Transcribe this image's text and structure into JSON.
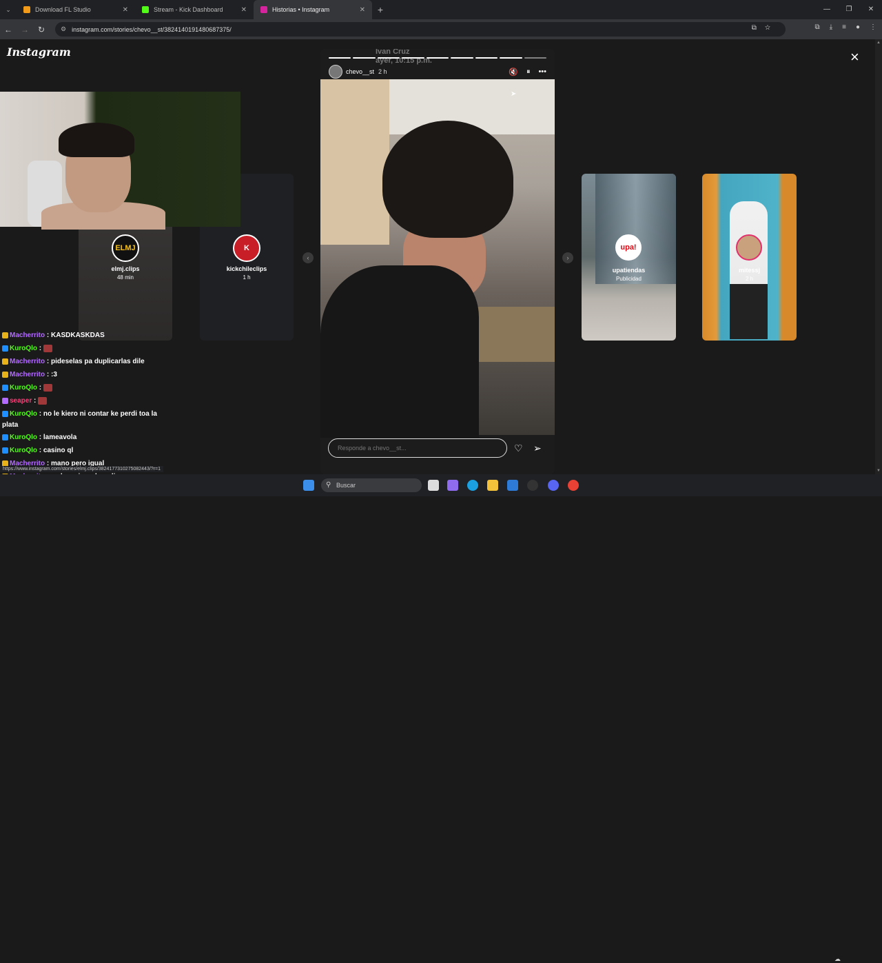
{
  "browser": {
    "tabs": [
      {
        "title": "Download FL Studio",
        "color": "#f29b1b",
        "active": false
      },
      {
        "title": "Stream - Kick Dashboard",
        "color": "#53fc18",
        "active": false
      },
      {
        "title": "Historias • Instagram",
        "color": "#d6249f",
        "active": true
      }
    ],
    "new_tab": "+",
    "url": "instagram.com/stories/chevo__st/3824140191480687375/",
    "status_url": "https://www.instagram.com/stories/elmj.clips/3824177310275082443/?r=1"
  },
  "instagram": {
    "logo": "Instagram",
    "close": "×",
    "story": {
      "faded_username": "Ivan Cruz",
      "faded_time": "ayer, 10:15 p.m.",
      "username": "chevo__st",
      "time": "2 h",
      "progress_segments": 9,
      "current_segment": 9,
      "reply_placeholder": "Responde a chevo__st..."
    },
    "left_previews": [
      {
        "name": "elmj.clips",
        "time": "48 min",
        "avatar_text": "ELMJ"
      },
      {
        "name": "kickchileclips",
        "time": "1 h",
        "avatar_text": "K"
      }
    ],
    "right_previews": [
      {
        "name": "upatiendas",
        "sub": "Publicidad",
        "avatar_text": "upa!"
      },
      {
        "name": "mitessj",
        "sub": "2 h",
        "avatar_text": ""
      }
    ]
  },
  "chat": {
    "messages": [
      {
        "user": "Macherrito",
        "color": "#b36bff",
        "text": ": KASDKASKDAS",
        "badges": "mod"
      },
      {
        "user": "KuroQlo",
        "color": "#53fc18",
        "text": ":",
        "badges": "kick",
        "emote": true
      },
      {
        "user": "Macherrito",
        "color": "#b36bff",
        "text": ": pideselas pa duplicarlas dile",
        "badges": "mod"
      },
      {
        "user": "Macherrito",
        "color": "#b36bff",
        "text": ": :3",
        "badges": "mod"
      },
      {
        "user": "KuroQlo",
        "color": "#53fc18",
        "text": ":",
        "badges": "kick",
        "emote": true
      },
      {
        "user": "seaper",
        "color": "#ff3c78",
        "text": ":",
        "badges": "sub",
        "emote": true
      },
      {
        "user": "KuroQlo",
        "color": "#53fc18",
        "text": ": no le kiero ni contar ke perdi toa la plata",
        "badges": "kick",
        "wrap": true
      },
      {
        "user": "KuroQlo",
        "color": "#53fc18",
        "text": ": lameavola",
        "badges": "kick"
      },
      {
        "user": "KuroQlo",
        "color": "#53fc18",
        "text": ": casino ql",
        "badges": "kick"
      },
      {
        "user": "Macherrito",
        "color": "#b36bff",
        "text": ": mano pero igual",
        "badges": "mod"
      },
      {
        "user": "Macherrito",
        "color": "#b36bff",
        "text": ": es la mejor adrenalina",
        "badges": "mod"
      },
      {
        "user": "Macherrito",
        "color": "#b36bff",
        "text": ":",
        "badges": "mod",
        "emote": true
      }
    ]
  },
  "taskbar": {
    "search_placeholder": "Buscar"
  }
}
